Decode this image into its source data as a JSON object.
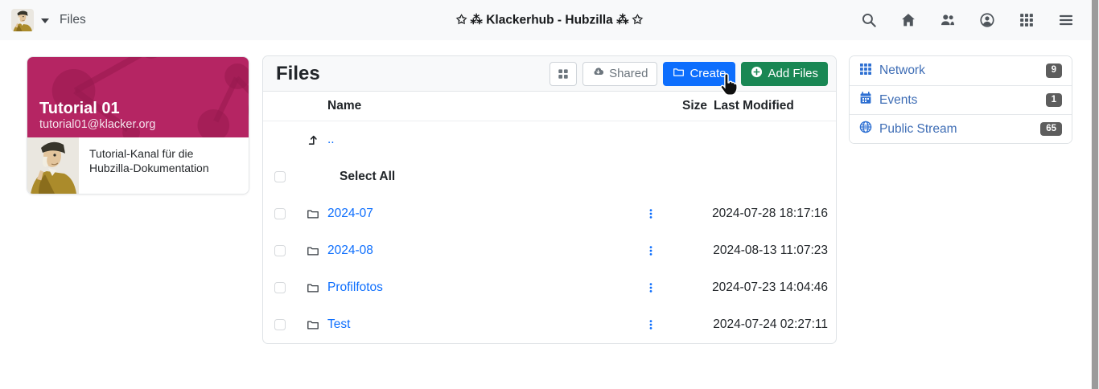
{
  "navbar": {
    "context_label": "Files",
    "title": "✩ ⁂ Klackerhub - Hubzilla ⁂ ✩"
  },
  "channel_card": {
    "name": "Tutorial 01",
    "address": "tutorial01@klacker.org",
    "description": "Tutorial-Kanal für die Hubzilla-Dokumentation"
  },
  "files": {
    "title": "Files",
    "toolbar": {
      "shared_label": "Shared",
      "create_label": "Create",
      "add_files_label": "Add Files"
    },
    "table": {
      "col_name": "Name",
      "col_size": "Size",
      "col_modified": "Last Modified",
      "parent_link": "..",
      "select_all_label": "Select All",
      "rows": [
        {
          "name": "2024-07",
          "size": "",
          "modified": "2024-07-28 18:17:16"
        },
        {
          "name": "2024-08",
          "size": "",
          "modified": "2024-08-13 11:07:23"
        },
        {
          "name": "Profilfotos",
          "size": "",
          "modified": "2024-07-23 14:04:46"
        },
        {
          "name": "Test",
          "size": "",
          "modified": "2024-07-24 02:27:11"
        }
      ]
    }
  },
  "widgets": {
    "items": [
      {
        "label": "Network",
        "count": "9"
      },
      {
        "label": "Events",
        "count": "1"
      },
      {
        "label": "Public Stream",
        "count": "65"
      }
    ]
  },
  "icons": {
    "nav_caret": "▾",
    "kebab": "⋮",
    "parent_arrow": "level-up-arrow"
  },
  "colors": {
    "accent_blue": "#0d6efd",
    "success_green": "#198754",
    "cover_magenta": "#b52563",
    "sidebar_link_blue": "#3e6db5",
    "badge_gray": "#5d5d5d",
    "navbar_bg": "#f8f9fa"
  }
}
